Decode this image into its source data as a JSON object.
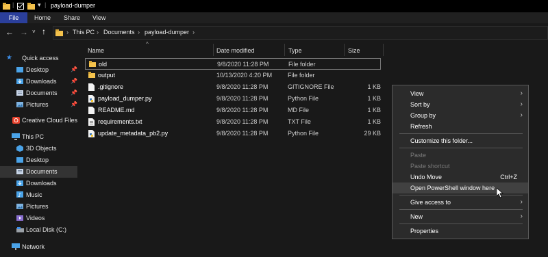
{
  "window": {
    "title": "payload-dumper"
  },
  "ribbon": {
    "tabs": [
      "File",
      "Home",
      "Share",
      "View"
    ]
  },
  "address": {
    "crumbs": [
      "This PC",
      "Documents",
      "payload-dumper"
    ]
  },
  "sidebar": {
    "items": [
      {
        "label": "Quick access",
        "icon": "star-icon"
      },
      {
        "label": "Desktop",
        "icon": "desktop-folder-icon",
        "pinned": true
      },
      {
        "label": "Downloads",
        "icon": "downloads-folder-icon",
        "pinned": true
      },
      {
        "label": "Documents",
        "icon": "documents-folder-icon",
        "pinned": true
      },
      {
        "label": "Pictures",
        "icon": "pictures-folder-icon",
        "pinned": true
      },
      {
        "label": "Creative Cloud Files",
        "icon": "creative-cloud-icon"
      },
      {
        "label": "This PC",
        "icon": "computer-icon"
      },
      {
        "label": "3D Objects",
        "icon": "3d-objects-icon"
      },
      {
        "label": "Desktop",
        "icon": "desktop-folder-icon"
      },
      {
        "label": "Documents",
        "icon": "documents-folder-icon",
        "selected": true
      },
      {
        "label": "Downloads",
        "icon": "downloads-folder-icon"
      },
      {
        "label": "Music",
        "icon": "music-folder-icon"
      },
      {
        "label": "Pictures",
        "icon": "pictures-folder-icon"
      },
      {
        "label": "Videos",
        "icon": "videos-folder-icon"
      },
      {
        "label": "Local Disk (C:)",
        "icon": "drive-icon"
      },
      {
        "label": "Network",
        "icon": "network-icon"
      }
    ]
  },
  "columns": {
    "name": "Name",
    "date": "Date modified",
    "type": "Type",
    "size": "Size"
  },
  "files": [
    {
      "name": "old",
      "date": "9/8/2020 11:28 PM",
      "type": "File folder",
      "size": "",
      "icon": "folder-icon"
    },
    {
      "name": "output",
      "date": "10/13/2020 4:20 PM",
      "type": "File folder",
      "size": "",
      "icon": "folder-icon"
    },
    {
      "name": ".gitignore",
      "date": "9/8/2020 11:28 PM",
      "type": "GITIGNORE File",
      "size": "1 KB",
      "icon": "file-icon"
    },
    {
      "name": "payload_dumper.py",
      "date": "9/8/2020 11:28 PM",
      "type": "Python File",
      "size": "1 KB",
      "icon": "python-file-icon"
    },
    {
      "name": "README.md",
      "date": "9/8/2020 11:28 PM",
      "type": "MD File",
      "size": "1 KB",
      "icon": "file-icon"
    },
    {
      "name": "requirements.txt",
      "date": "9/8/2020 11:28 PM",
      "type": "TXT File",
      "size": "1 KB",
      "icon": "text-file-icon"
    },
    {
      "name": "update_metadata_pb2.py",
      "date": "9/8/2020 11:28 PM",
      "type": "Python File",
      "size": "29 KB",
      "icon": "python-file-icon"
    }
  ],
  "context_menu": {
    "items": [
      {
        "label": "View",
        "submenu": true
      },
      {
        "label": "Sort by",
        "submenu": true
      },
      {
        "label": "Group by",
        "submenu": true
      },
      {
        "label": "Refresh"
      },
      {
        "label": "Customize this folder..."
      },
      {
        "label": "Paste",
        "disabled": true
      },
      {
        "label": "Paste shortcut",
        "disabled": true
      },
      {
        "label": "Undo Move",
        "shortcut": "Ctrl+Z"
      },
      {
        "label": "Open PowerShell window here",
        "highlighted": true
      },
      {
        "label": "Give access to",
        "submenu": true
      },
      {
        "label": "New",
        "submenu": true
      },
      {
        "label": "Properties"
      }
    ]
  },
  "colors": {
    "accent": "#2b3f9b",
    "folder": "#f4c24c",
    "background": "#191919"
  }
}
